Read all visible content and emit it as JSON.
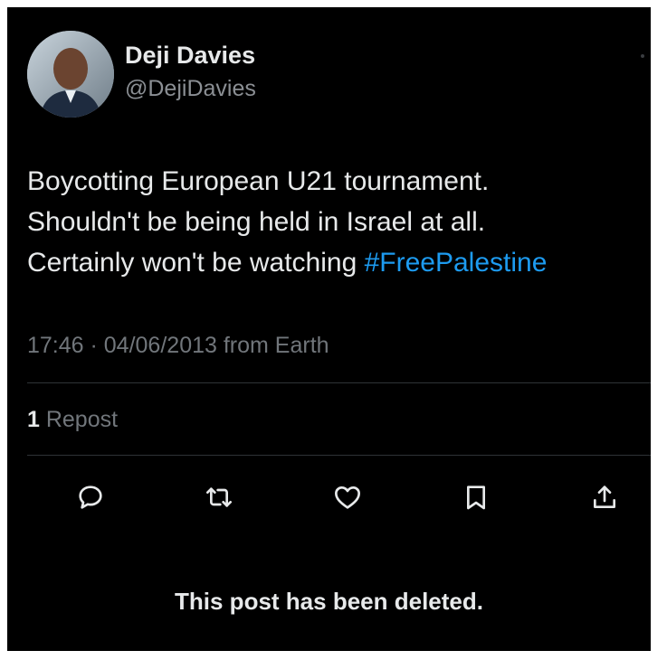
{
  "author": {
    "display_name": "Deji Davies",
    "handle": "@DejiDavies"
  },
  "tweet": {
    "lines": [
      "Boycotting European U21 tournament.",
      "Shouldn't be being held in Israel at all.",
      "Certainly won't be watching "
    ],
    "hashtag": "#FreePalestine",
    "timestamp_text": "17:46 · 04/06/2013 from Earth"
  },
  "stats": {
    "repost_count": "1",
    "repost_label": " Repost"
  },
  "actions": [
    {
      "name": "reply",
      "icon": "reply-icon"
    },
    {
      "name": "repost",
      "icon": "repost-icon"
    },
    {
      "name": "like",
      "icon": "heart-icon"
    },
    {
      "name": "bookmark",
      "icon": "bookmark-icon"
    },
    {
      "name": "share",
      "icon": "share-icon"
    }
  ],
  "notice": "This post has been deleted.",
  "colors": {
    "background": "#000000",
    "text": "#e7e9ea",
    "secondary_text": "#71767b",
    "link": "#1d9bf0"
  }
}
